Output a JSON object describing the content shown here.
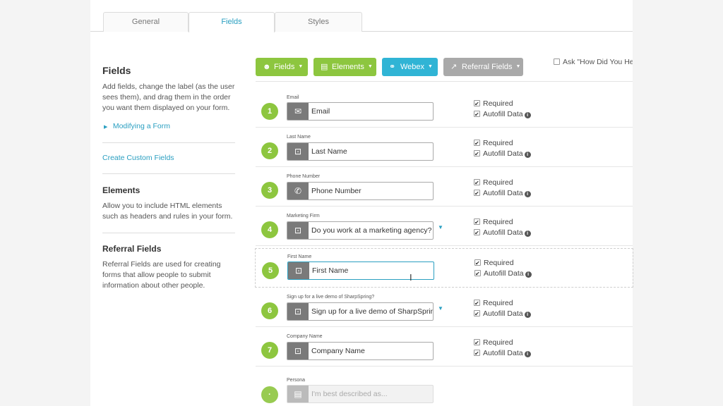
{
  "tabs": [
    {
      "label": "General"
    },
    {
      "label": "Fields"
    },
    {
      "label": "Styles"
    }
  ],
  "sidebar": {
    "fields_title": "Fields",
    "fields_desc": "Add fields, change the label (as the user sees them), and drag them in the order you want them displayed on your form.",
    "modifying_link": "Modifying a Form",
    "custom_fields_link": "Create Custom Fields",
    "elements_title": "Elements",
    "elements_desc": "Allow you to include HTML elements such as headers and rules in your form.",
    "referral_title": "Referral Fields",
    "referral_desc": "Referral Fields are used for creating forms that allow people to submit information about other people."
  },
  "toolbar": {
    "fields_label": "Fields",
    "elements_label": "Elements",
    "webex_label": "Webex",
    "referral_label": "Referral Fields",
    "ask_label": "Ask \"How Did You He"
  },
  "options": {
    "required": "Required",
    "autofill": "Autofill Data"
  },
  "fields": [
    {
      "num": "1",
      "label": "Email",
      "value": "Email",
      "icon": "envelope-icon"
    },
    {
      "num": "2",
      "label": "Last Name",
      "value": "Last Name",
      "icon": "text-field-icon"
    },
    {
      "num": "3",
      "label": "Phone Number",
      "value": "Phone Number",
      "icon": "phone-icon"
    },
    {
      "num": "4",
      "label": "Marketing Firm",
      "value": "Do you work at a marketing agency?",
      "icon": "text-field-icon"
    },
    {
      "num": "5",
      "label": "First Name",
      "value": "First Name",
      "icon": "text-field-icon"
    },
    {
      "num": "6",
      "label": "Sign up for a live demo of SharpSpring?",
      "value": "Sign up for a live demo of SharpSpring",
      "icon": "text-field-icon"
    },
    {
      "num": "7",
      "label": "Company Name",
      "value": "Company Name",
      "icon": "text-field-icon"
    },
    {
      "num": "·",
      "label": "Persona",
      "value": "I'm best described as...",
      "icon": "list-icon"
    }
  ],
  "colors": {
    "accent_green": "#8dc63f",
    "accent_teal": "#30b4d5",
    "link_blue": "#2a9fc1",
    "gray_button": "#a9a9a9"
  }
}
